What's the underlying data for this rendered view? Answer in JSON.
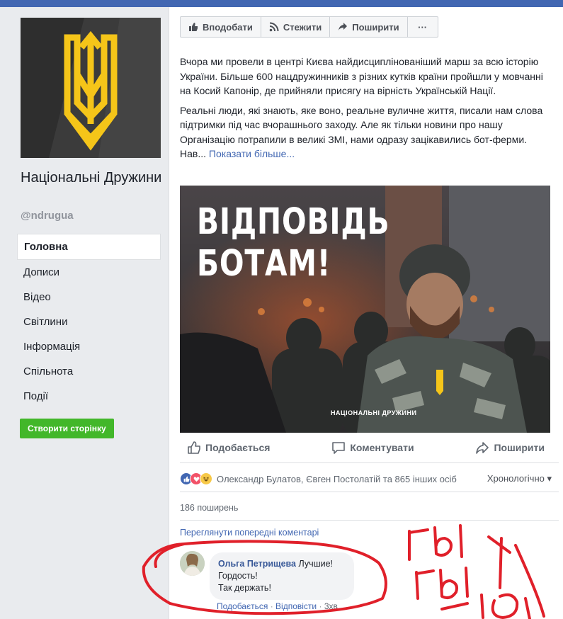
{
  "page": {
    "name": "Національні Дружини",
    "handle": "@ndrugua"
  },
  "sidebar": {
    "items": [
      {
        "label": "Головна",
        "active": true
      },
      {
        "label": "Дописи"
      },
      {
        "label": "Відео"
      },
      {
        "label": "Світлини"
      },
      {
        "label": "Інформація"
      },
      {
        "label": "Спільнота"
      },
      {
        "label": "Події"
      }
    ],
    "create_button": "Створити сторінку"
  },
  "actionbar": {
    "like": "Вподобати",
    "follow": "Стежити",
    "share": "Поширити",
    "more": "···"
  },
  "post": {
    "paragraph1": "Вчора ми провели в центрі Києва найдисциплінованіший марш за всю історію України. Більше 600 нацдружинників з різних кутків країни пройшли у мовчанні на Косий Капонір, де прийняли присягу на вірність Українській Нації.",
    "paragraph2": "Реальні люди, які знають, яке воно, реальне вуличне життя, писали нам слова підтримки під час вчорашнього заходу. Але як тільки новини про нашу Організацію потрапили в великі ЗМІ, нами одразу зацікавились бот-ферми. Нав...",
    "see_more": "Показати більше...",
    "image_title_line1": "ВІДПОВІДЬ",
    "image_title_line2": "БОТАМ!",
    "image_watermark": "НАЦІОНАЛЬНІ ДРУЖИНИ"
  },
  "reactions": {
    "like": "Подобається",
    "comment": "Коментувати",
    "share": "Поширити"
  },
  "stats": {
    "likers": "Олександр Булатов, Євген Постолатій та 865 інших осіб",
    "sort": "Хронологічно ▾",
    "shares": "186 поширень",
    "prev_comments": "Переглянути попередні коментарі"
  },
  "comment": {
    "author": "Ольга Петрищева",
    "line1": "Лучшие!",
    "line2": "Гордость!",
    "line3": "Так держать!",
    "like": "Подобається",
    "reply": "Відповісти",
    "time": "3хв"
  },
  "annotation": {
    "scrawl": "ГЫ ГЫ ГЫ",
    "color": "#e0202a"
  },
  "colors": {
    "facebook_blue": "#4267b2",
    "link": "#385898",
    "create_green": "#42b72a",
    "logo_yellow": "#f5c519"
  }
}
